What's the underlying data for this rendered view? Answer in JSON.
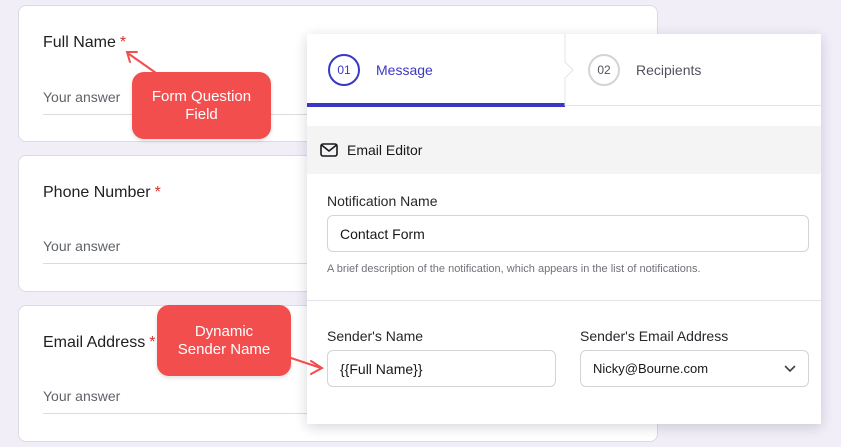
{
  "form": {
    "questions": [
      {
        "title": "Full Name",
        "required_mark": "*",
        "answer_placeholder": "Your answer"
      },
      {
        "title": "Phone Number",
        "required_mark": "*",
        "answer_placeholder": "Your answer"
      },
      {
        "title": "Email Address",
        "required_mark": "*",
        "answer_placeholder": "Your answer"
      }
    ]
  },
  "callouts": {
    "form_question": {
      "line1": "Form Question",
      "line2": "Field"
    },
    "dynamic_sender": {
      "line1": "Dynamic",
      "line2": "Sender Name"
    }
  },
  "panel": {
    "tabs": [
      {
        "step": "01",
        "label": "Message",
        "active": true
      },
      {
        "step": "02",
        "label": "Recipients",
        "active": false
      }
    ],
    "editor_bar": {
      "icon": "mail-icon",
      "label": "Email Editor"
    },
    "notification_name": {
      "label": "Notification Name",
      "value": "Contact Form",
      "help": "A brief description of the notification, which appears in the list of notifications."
    },
    "sender_name": {
      "label": "Sender's Name",
      "value": "{{Full Name}}"
    },
    "sender_email": {
      "label": "Sender's Email Address",
      "value": "Nicky@Bourne.com"
    }
  },
  "colors": {
    "accent": "#3a37c5",
    "callout": "#f24e4e",
    "required": "#d93025",
    "background": "#f1eef8"
  }
}
